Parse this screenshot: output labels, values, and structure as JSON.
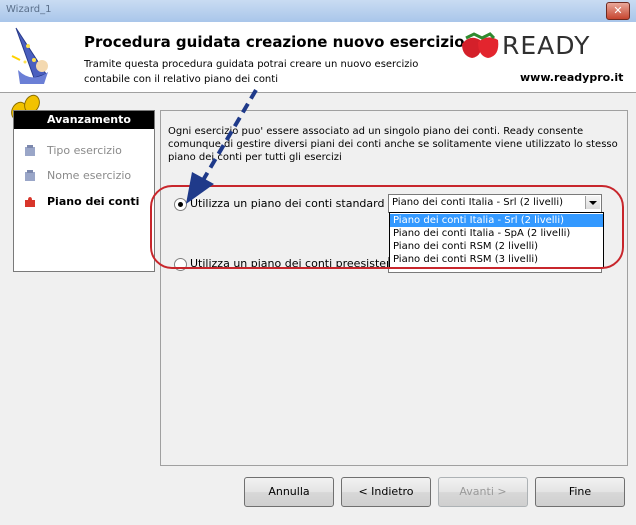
{
  "window": {
    "title": "Wizard_1"
  },
  "header": {
    "title": "Procedura guidata creazione nuovo esercizio",
    "description": "Tramite questa procedura guidata potrai creare un nuovo esercizio contabile con il relativo piano dei conti",
    "logo_text": "READY",
    "website": "www.readypro.it"
  },
  "sidebar": {
    "heading": "Avanzamento",
    "items": [
      {
        "label": "Tipo esercizio",
        "state": "done"
      },
      {
        "label": "Nome esercizio",
        "state": "done"
      },
      {
        "label": "Piano dei conti",
        "state": "current"
      }
    ]
  },
  "main": {
    "intro": "Ogni esercizio puo' essere associato ad un singolo piano dei conti. Ready consente comunque di gestire diversi piani dei conti anche se solitamente viene utilizzato lo stesso piano dei conti per tutti gli esercizi",
    "option_standard": "Utilizza un piano dei conti standard",
    "option_existing": "Utilizza un piano dei conti preesistente",
    "selected_plan": "Piano dei conti Italia - Srl (2 livelli)",
    "plan_options": [
      "Piano dei conti Italia - Srl (2 livelli)",
      "Piano dei conti Italia - SpA (2 livelli)",
      "Piano dei conti RSM (2 livelli)",
      "Piano dei conti RSM (3 livelli)"
    ]
  },
  "buttons": {
    "cancel": "Annulla",
    "back": "< Indietro",
    "next": "Avanti >",
    "finish": "Fine"
  },
  "colors": {
    "highlight": "#c8262c",
    "arrow": "#1f3a8a",
    "selection": "#3399ff"
  }
}
